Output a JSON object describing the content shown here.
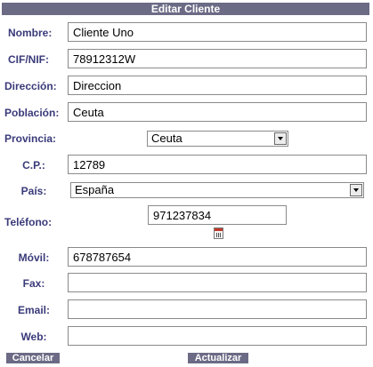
{
  "form": {
    "title": "Editar Cliente",
    "fields": {
      "nombre": {
        "label": "Nombre:",
        "value": "Cliente Uno"
      },
      "cif": {
        "label": "CIF/NIF:",
        "value": "78912312W"
      },
      "direccion": {
        "label": "Dirección:",
        "value": "Direccion"
      },
      "poblacion": {
        "label": "Población:",
        "value": "Ceuta"
      },
      "provincia": {
        "label": "Provincia:",
        "value": "Ceuta"
      },
      "cp": {
        "label": "C.P.:",
        "value": "12789"
      },
      "pais": {
        "label": "País:",
        "value": "España"
      },
      "telefono": {
        "label": "Teléfono:",
        "value": "971237834"
      },
      "movil": {
        "label": "Móvil:",
        "value": "678787654"
      },
      "fax": {
        "label": "Fax:",
        "value": ""
      },
      "email": {
        "label": "Email:",
        "value": ""
      },
      "web": {
        "label": "Web:",
        "value": ""
      }
    },
    "buttons": {
      "cancel": "Cancelar",
      "update": "Actualizar"
    }
  },
  "colors": {
    "header_bg": "#6b6b86",
    "label_text": "#3a3a7a",
    "button_bg": "#6b6b86"
  }
}
